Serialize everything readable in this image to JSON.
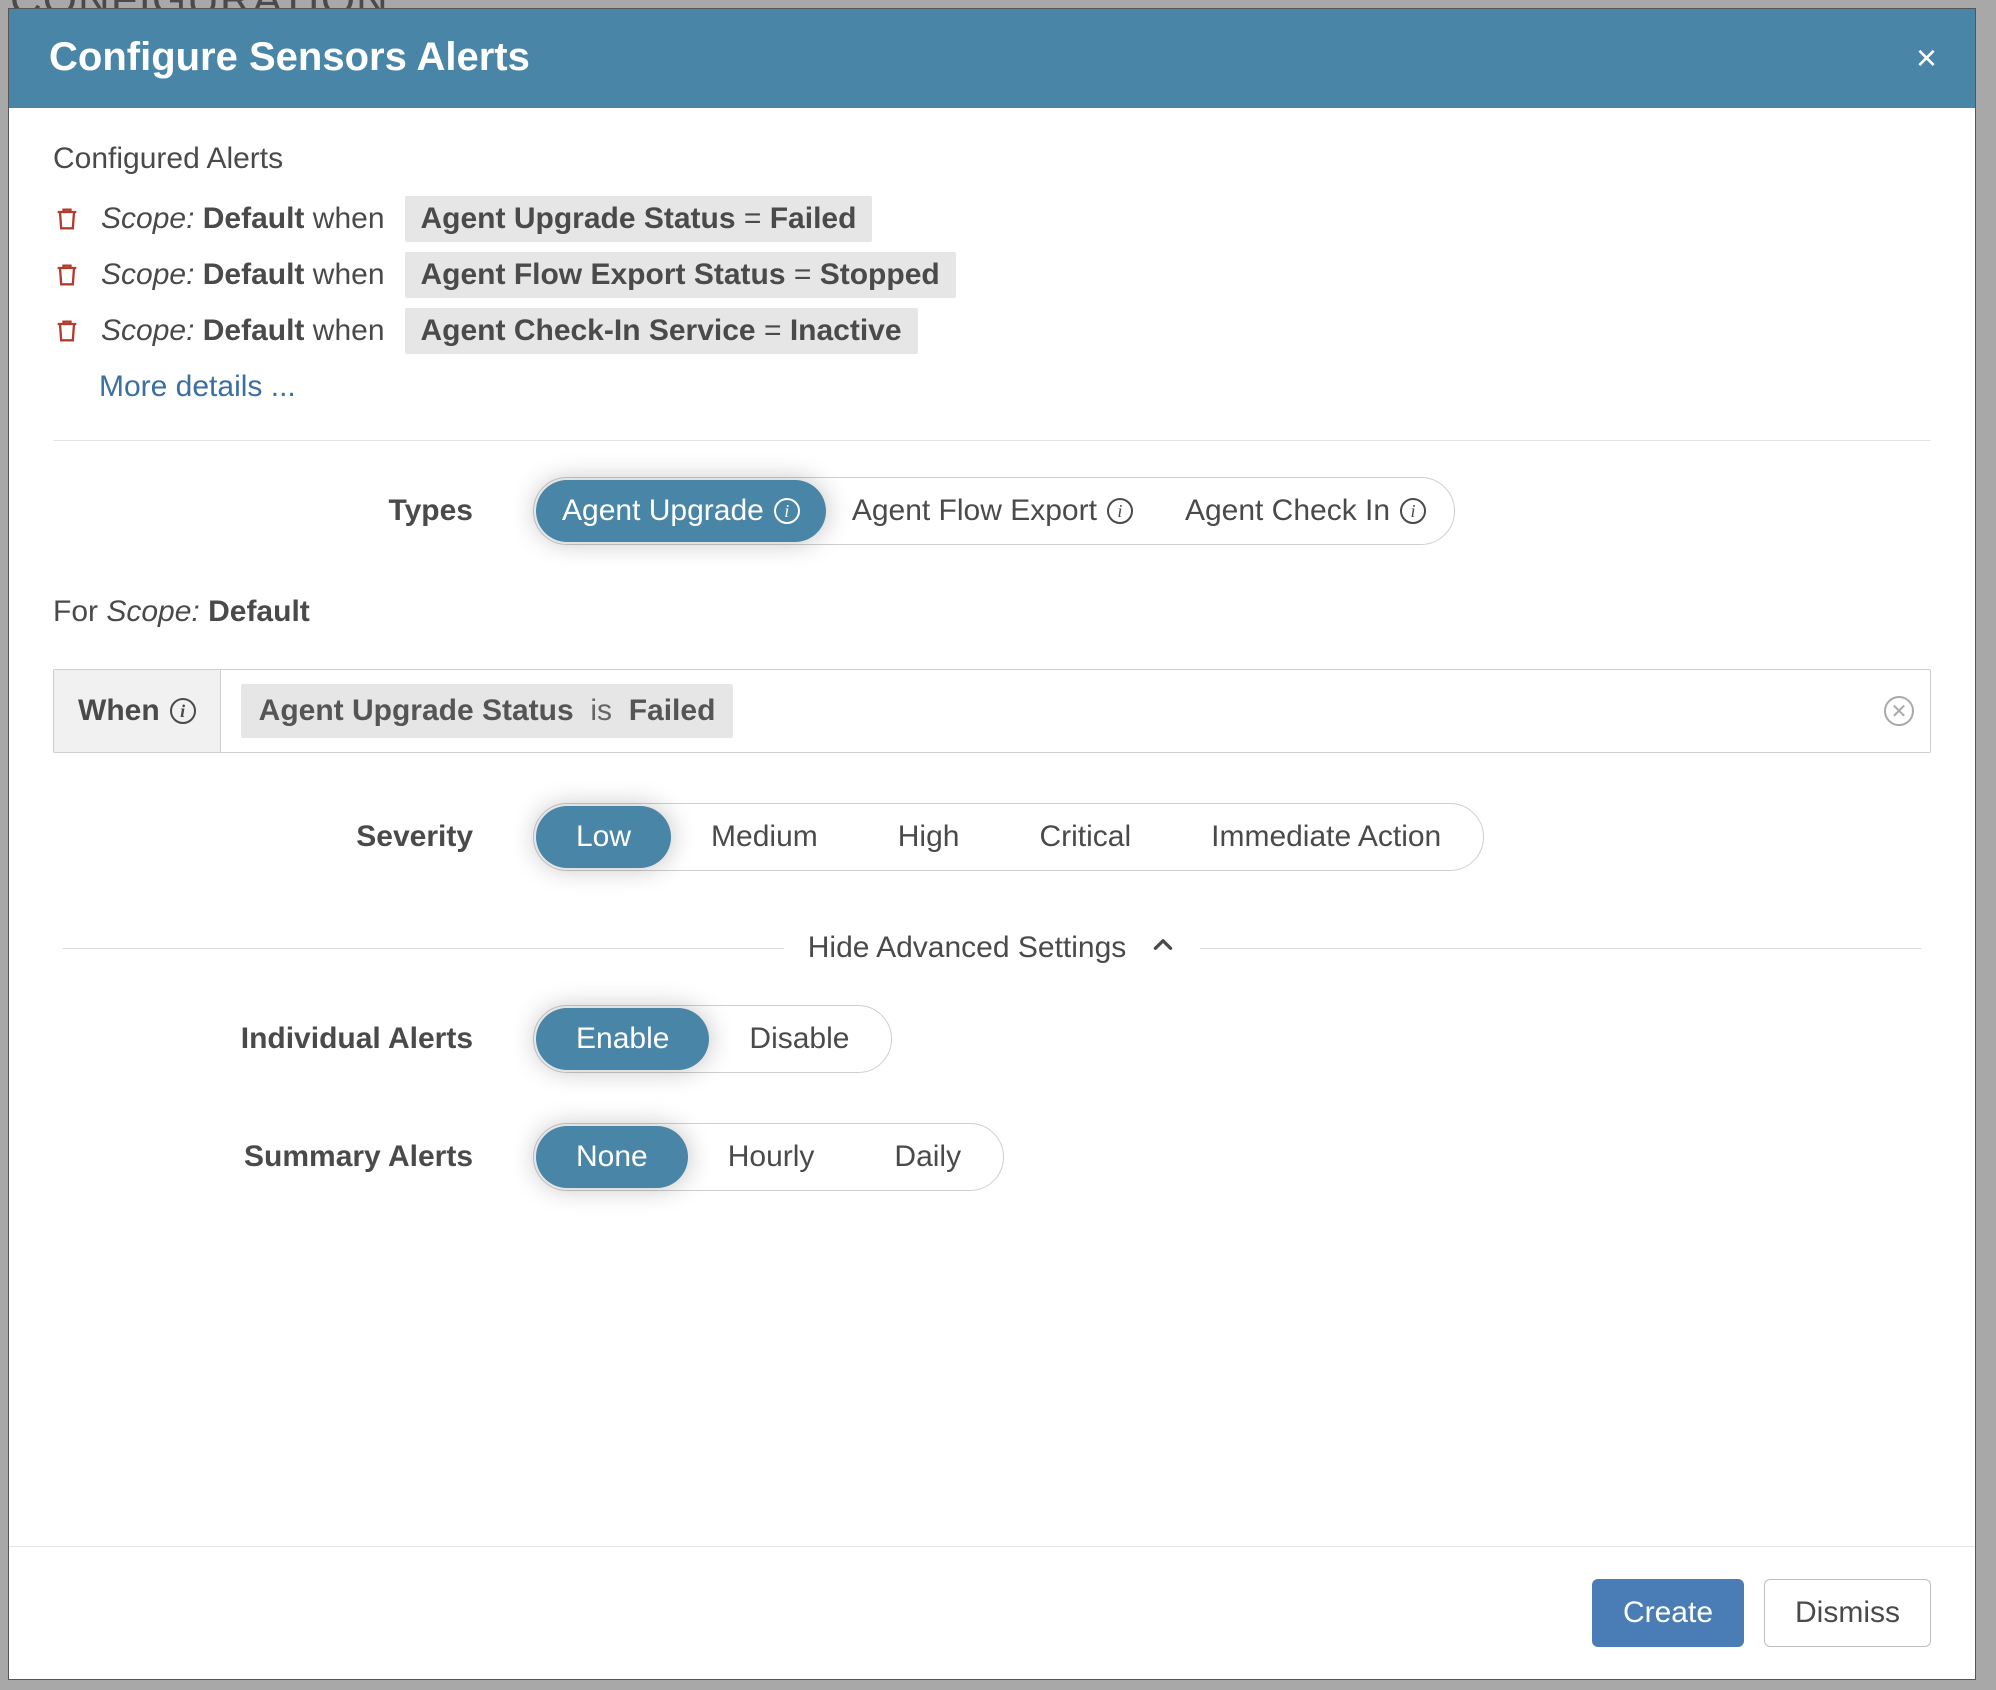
{
  "backdrop": {
    "title": "CONFIGURATION"
  },
  "modal": {
    "title": "Configure Sensors Alerts",
    "close": "×"
  },
  "configured": {
    "heading": "Configured Alerts",
    "scope_label": "Scope:",
    "default": "Default",
    "when": "when",
    "rows": [
      {
        "metric": "Agent Upgrade Status",
        "op": "=",
        "value": "Failed"
      },
      {
        "metric": "Agent Flow Export Status",
        "op": "=",
        "value": "Stopped"
      },
      {
        "metric": "Agent Check-In Service",
        "op": "=",
        "value": "Inactive"
      }
    ],
    "more": "More details ..."
  },
  "types": {
    "label": "Types",
    "options": [
      "Agent Upgrade",
      "Agent Flow Export",
      "Agent Check In"
    ],
    "selected": "Agent Upgrade"
  },
  "for_scope": {
    "prefix": "For",
    "scope": "Scope:",
    "value": "Default"
  },
  "when_bar": {
    "label": "When",
    "metric": "Agent Upgrade Status",
    "is": "is",
    "value": "Failed"
  },
  "severity": {
    "label": "Severity",
    "options": [
      "Low",
      "Medium",
      "High",
      "Critical",
      "Immediate Action"
    ],
    "selected": "Low"
  },
  "advanced": {
    "toggle": "Hide Advanced Settings"
  },
  "individual": {
    "label": "Individual Alerts",
    "options": [
      "Enable",
      "Disable"
    ],
    "selected": "Enable"
  },
  "summary": {
    "label": "Summary Alerts",
    "options": [
      "None",
      "Hourly",
      "Daily"
    ],
    "selected": "None"
  },
  "footer": {
    "create": "Create",
    "dismiss": "Dismiss"
  },
  "info_glyph": "i"
}
